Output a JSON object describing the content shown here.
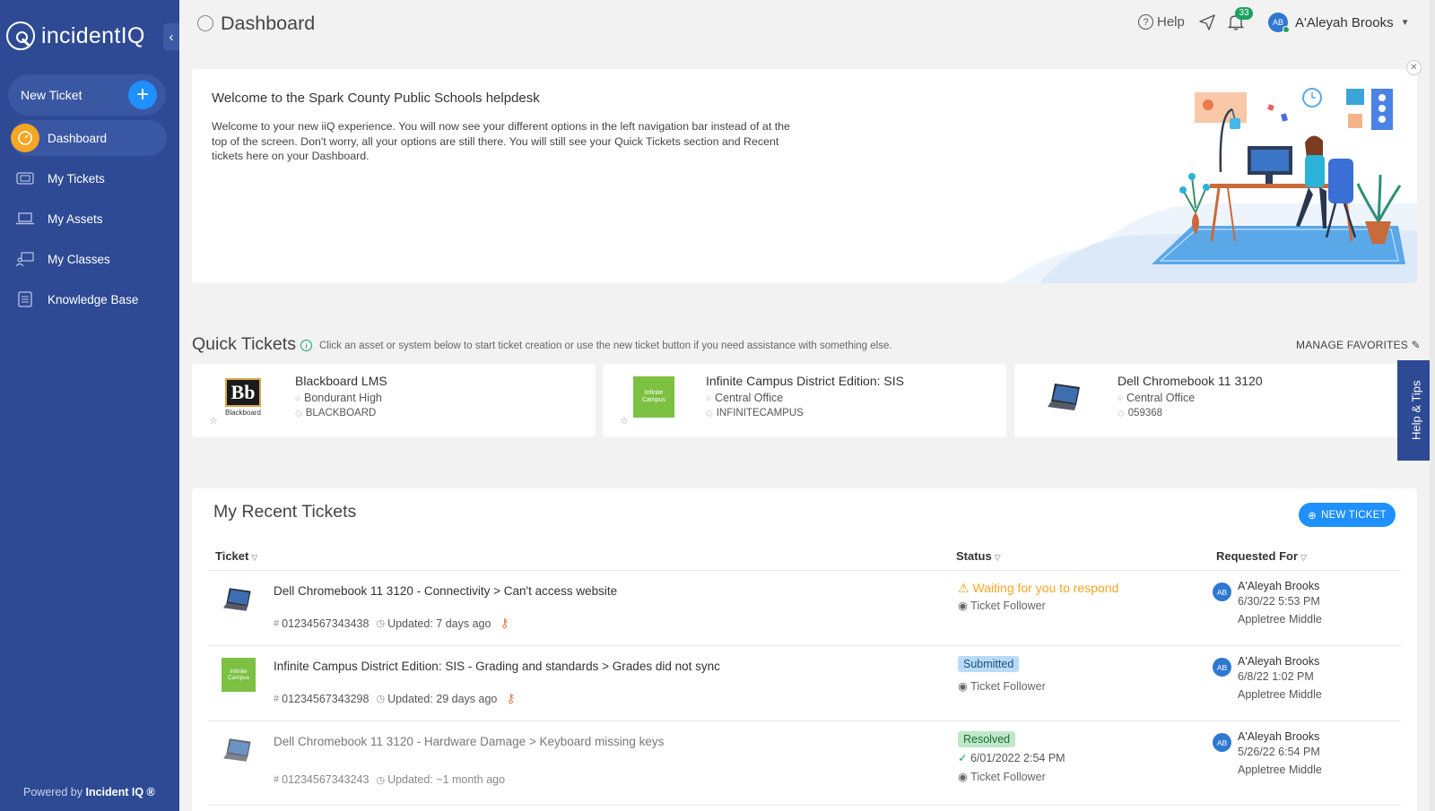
{
  "sidebar": {
    "logo_text": "incidentIQ",
    "new_ticket_label": "New Ticket",
    "items": [
      {
        "label": "Dashboard",
        "icon": "speedometer-icon",
        "active": true
      },
      {
        "label": "My Tickets",
        "icon": "ticket-icon"
      },
      {
        "label": "My Assets",
        "icon": "laptop-icon"
      },
      {
        "label": "My Classes",
        "icon": "classroom-icon"
      },
      {
        "label": "Knowledge Base",
        "icon": "book-icon"
      }
    ],
    "powered_prefix": "Powered by",
    "powered_brand": "Incident IQ ®"
  },
  "header": {
    "title": "Dashboard",
    "help_label": "Help",
    "notification_count": "33",
    "user_initials": "AB",
    "user_name": "A'Aleyah Brooks"
  },
  "welcome": {
    "title": "Welcome to the Spark County Public Schools helpdesk",
    "body": "Welcome to your new iiQ experience. You will now see your different options in the left navigation bar instead of at the top of the screen. Don't worry, all your options are still there. You will still see your Quick Tickets section and Recent tickets here on your Dashboard."
  },
  "quick_tickets": {
    "title": "Quick Tickets",
    "description": "Click an asset or system below to start ticket creation or use the new ticket button if you need assistance with something else.",
    "manage_label": "MANAGE FAVORITES",
    "cards": [
      {
        "name": "Blackboard LMS",
        "location": "Bondurant High",
        "tag": "BLACKBOARD",
        "thumb": "blackboard-logo",
        "thumb_text": "Bb",
        "thumb_caption": "Blackboard"
      },
      {
        "name": "Infinite Campus District Edition: SIS",
        "location": "Central Office",
        "tag": "INFINITECAMPUS",
        "thumb": "infinite-campus-logo",
        "thumb_text": "Infinite Campus"
      },
      {
        "name": "Dell Chromebook 11 3120",
        "location": "Central Office",
        "tag": "059368",
        "thumb": "laptop-image"
      }
    ],
    "help_tips_label": "Help & Tips"
  },
  "recent": {
    "title": "My Recent Tickets",
    "new_ticket_button": "NEW TICKET",
    "columns": [
      "Ticket",
      "Status",
      "Requested For"
    ],
    "rows": [
      {
        "subject": "Dell Chromebook 11 3120 - Connectivity > Can't access website",
        "number": "01234567343438",
        "updated": "Updated: 7 days ago",
        "status": "Waiting for you to respond",
        "status_type": "waiting",
        "follower": "Ticket Follower",
        "req_initials": "AB",
        "req_name": "A'Aleyah Brooks",
        "req_date": "6/30/22 5:53 PM",
        "req_school": "Appletree Middle",
        "icon": "laptop-image"
      },
      {
        "subject": "Infinite Campus District Edition: SIS - Grading and standards > Grades did not sync",
        "number": "01234567343298",
        "updated": "Updated: 29 days ago",
        "status": "Submitted",
        "status_type": "submitted",
        "follower": "Ticket Follower",
        "req_initials": "AB",
        "req_name": "A'Aleyah Brooks",
        "req_date": "6/8/22 1:02 PM",
        "req_school": "Appletree Middle",
        "icon": "infinite-campus-logo",
        "icon_text": "Infinite Campus"
      },
      {
        "subject": "Dell Chromebook 11 3120 - Hardware Damage > Keyboard missing keys",
        "number": "01234567343243",
        "updated": "Updated: ~1 month ago",
        "status": "Resolved",
        "status_type": "resolved",
        "resolved_date": "6/01/2022 2:54 PM",
        "follower": "Ticket Follower",
        "req_initials": "AB",
        "req_name": "A'Aleyah Brooks",
        "req_date": "5/26/22 6:54 PM",
        "req_school": "Appletree Middle",
        "icon": "laptop-image"
      }
    ]
  },
  "colors": {
    "sidebar": "#2e4a94",
    "accent_blue": "#1e90ff",
    "active_orange": "#f5a623",
    "success_green": "#1aa260"
  }
}
